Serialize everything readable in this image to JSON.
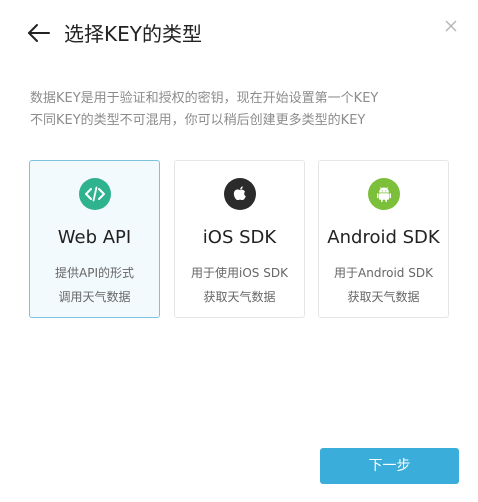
{
  "dialog": {
    "title": "选择KEY的类型",
    "description_lines": [
      "数据KEY是用于验证和授权的密钥，现在开始设置第一个KEY",
      "不同KEY的类型不可混用，你可以稍后创建更多类型的KEY"
    ]
  },
  "options": [
    {
      "name": "Web API",
      "sub_lines": [
        "提供API的形式",
        "调用天气数据"
      ],
      "icon": "code-icon",
      "icon_color": "#2fb38e",
      "selected": true
    },
    {
      "name": "iOS SDK",
      "sub_lines": [
        "用于使用iOS SDK",
        "获取天气数据"
      ],
      "icon": "apple-icon",
      "icon_color": "#2b2b2b",
      "selected": false
    },
    {
      "name": "Android SDK",
      "sub_lines": [
        "用于Android SDK",
        "获取天气数据"
      ],
      "icon": "android-icon",
      "icon_color": "#7cbf3a",
      "selected": false
    }
  ],
  "footer": {
    "next_label": "下一步"
  },
  "colors": {
    "accent": "#3aaddb",
    "selected_border": "#7cc3df",
    "selected_bg": "#f3fafd"
  }
}
